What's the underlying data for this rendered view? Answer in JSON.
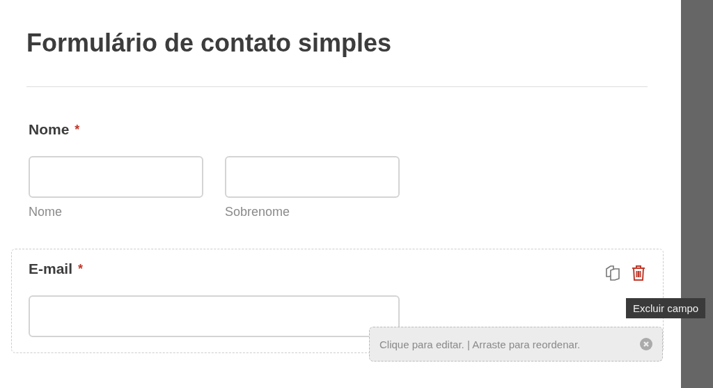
{
  "form": {
    "title": "Formulário de contato simples",
    "fields": [
      {
        "label": "Nome",
        "required_mark": "*",
        "selected": false,
        "inputs": [
          {
            "kind": "text",
            "sublabel": "Nome"
          },
          {
            "kind": "text",
            "sublabel": "Sobrenome"
          }
        ]
      },
      {
        "label": "E-mail",
        "required_mark": "*",
        "selected": true,
        "inputs": [
          {
            "kind": "email"
          }
        ]
      }
    ]
  },
  "field_actions": {
    "tooltip": "Excluir campo"
  },
  "hint": {
    "text": "Clique para editar. | Arraste para reordenar."
  }
}
